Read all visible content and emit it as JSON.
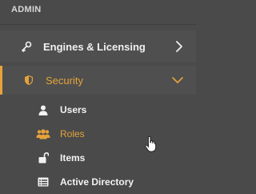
{
  "section": {
    "title": "ADMIN"
  },
  "nav": {
    "engines": {
      "label": "Engines & Licensing",
      "icon": "key-icon",
      "trail_icon": "chevron-right-icon"
    },
    "security": {
      "label": "Security",
      "icon": "shield-icon",
      "trail_icon": "chevron-down-icon",
      "expanded": true,
      "items": [
        {
          "label": "Users",
          "icon": "user-icon",
          "active": false
        },
        {
          "label": "Roles",
          "icon": "users-group-icon",
          "active": true
        },
        {
          "label": "Items",
          "icon": "unlock-icon",
          "active": false
        },
        {
          "label": "Active Directory",
          "icon": "directory-card-icon",
          "active": false
        }
      ]
    }
  },
  "colors": {
    "background": "#4a4a4a",
    "row_background": "#4f4f4f",
    "accent": "#e6a33a",
    "text": "#f2f2f2",
    "header_text": "#d6d6d6"
  }
}
